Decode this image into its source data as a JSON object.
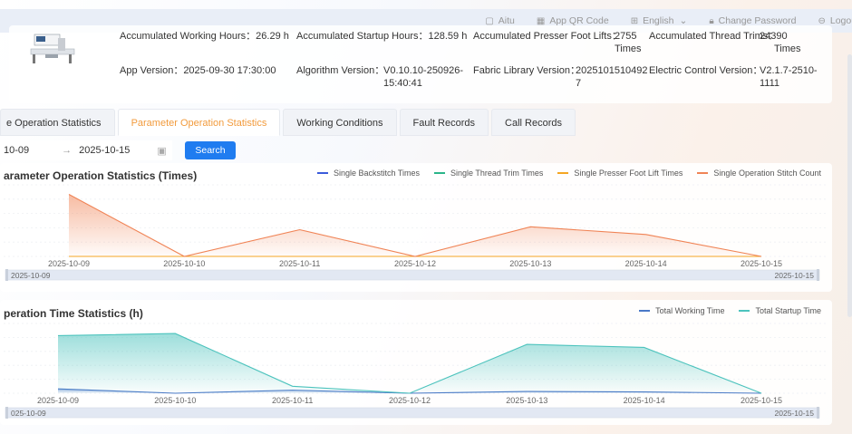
{
  "topbar": {
    "aitu_label": "Aitu",
    "qr_label": "App QR Code",
    "lang_label": "English",
    "password_label": "Change Password",
    "logout_label": "Logout"
  },
  "info": {
    "working_hours": "Accumulated Working Hours：26.29 h",
    "startup_hours": "Accumulated Startup Hours：128.59 h",
    "presser_label": "Accumulated Presser Foot Lifts：",
    "presser_value_1": "2755",
    "presser_value_2": "Times",
    "trims_label": "Accumulated Thread Trims：",
    "trims_value_1": "24390",
    "trims_value_2": "Times",
    "app_version": "App Version：2025-09-30 17:30:00",
    "algo_label": "Algorithm Version：",
    "algo_value_1": "V0.10.10-250926-",
    "algo_value_2": "15:40:41",
    "fabric_label": "Fabric Library Version：",
    "fabric_value_1": "2025101510492",
    "fabric_value_2": "7",
    "ec_label": "Electric Control Version：",
    "ec_value_1": "V2.1.7-2510-",
    "ec_value_2": "1111"
  },
  "tabs": [
    {
      "label": "e Operation Statistics"
    },
    {
      "label": "Parameter Operation Statistics"
    },
    {
      "label": "Working Conditions"
    },
    {
      "label": "Fault Records"
    },
    {
      "label": "Call Records"
    }
  ],
  "filter": {
    "start_date": "10-09",
    "arrow": "→",
    "end_date": "2025-10-15",
    "search_label": "Search"
  },
  "colors": {
    "backstitch": "#3b5bdb",
    "thread_trim": "#2bb58a",
    "presser": "#f5a623",
    "stitch_count": "#f08456",
    "working": "#4a78c7",
    "startup": "#4cc3bd",
    "accent": "#f29b3d",
    "button": "#1f7cf0"
  },
  "chart_data": [
    {
      "type": "area",
      "title": "arameter Operation Statistics (Times)",
      "categories": [
        "2025-10-09",
        "2025-10-10",
        "2025-10-11",
        "2025-10-12",
        "2025-10-13",
        "2025-10-14",
        "2025-10-15"
      ],
      "series": [
        {
          "name": "Single Backstitch Times",
          "values": [
            0,
            0,
            0,
            0,
            0,
            0,
            0
          ]
        },
        {
          "name": "Single Thread Trim Times",
          "values": [
            0,
            0,
            0,
            0,
            0,
            0,
            0
          ]
        },
        {
          "name": "Single Presser Foot Lift Times",
          "values": [
            0,
            0,
            0,
            0,
            0,
            0,
            0
          ]
        },
        {
          "name": "Single Operation Stitch Count",
          "values": [
            65,
            0,
            28,
            0,
            31,
            23,
            0
          ]
        }
      ],
      "ylim": [
        0,
        75
      ],
      "grid": true,
      "legend": "top-right",
      "zoom_start": "2025-10-09",
      "zoom_end": "2025-10-15"
    },
    {
      "type": "area",
      "title": "peration Time Statistics (h)",
      "categories": [
        "2025-10-09",
        "2025-10-10",
        "2025-10-11",
        "2025-10-12",
        "2025-10-13",
        "2025-10-14",
        "2025-10-15"
      ],
      "series": [
        {
          "name": "Total Working Time",
          "values": [
            1,
            0,
            0.7,
            0,
            0.4,
            0.3,
            0
          ]
        },
        {
          "name": "Total Startup Time",
          "values": [
            13.2,
            13.7,
            1.6,
            0,
            11.2,
            10.5,
            0
          ]
        }
      ],
      "ylim": [
        0,
        16
      ],
      "grid": true,
      "legend": "top-right",
      "zoom_start": "025-10-09",
      "zoom_end": "2025-10-15"
    }
  ]
}
